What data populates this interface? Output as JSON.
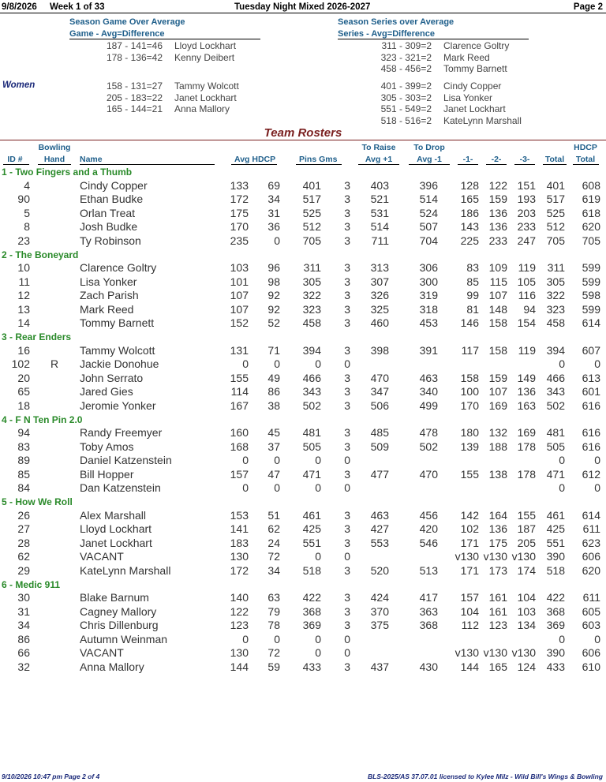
{
  "header": {
    "date": "9/8/2026",
    "week": "Week 1 of 33",
    "league": "Tuesday Night Mixed 2026-2027",
    "page": "Page 2"
  },
  "averages": {
    "game_title": "Season Game Over Average",
    "game_sub": "Game - Avg=Difference",
    "series_title": "Season Series over Average",
    "series_sub": "Series - Avg=Difference",
    "women_label": "Women",
    "men_game": [
      {
        "stat": "187 - 141=46",
        "name": "Lloyd Lockhart"
      },
      {
        "stat": "178 - 136=42",
        "name": "Kenny Deibert"
      }
    ],
    "men_series": [
      {
        "stat": "311 - 309=2",
        "name": "Clarence Goltry"
      },
      {
        "stat": "323 - 321=2",
        "name": "Mark Reed"
      },
      {
        "stat": "458 - 456=2",
        "name": "Tommy Barnett"
      }
    ],
    "women_game": [
      {
        "stat": "158 - 131=27",
        "name": "Tammy Wolcott"
      },
      {
        "stat": "205 - 183=22",
        "name": "Janet Lockhart"
      },
      {
        "stat": "165 - 144=21",
        "name": "Anna Mallory"
      }
    ],
    "women_series": [
      {
        "stat": "401 - 399=2",
        "name": "Cindy Copper"
      },
      {
        "stat": "305 - 303=2",
        "name": "Lisa Yonker"
      },
      {
        "stat": "551 - 549=2",
        "name": "Janet Lockhart"
      },
      {
        "stat": "518 - 516=2",
        "name": "KateLynn Marshall"
      }
    ]
  },
  "rosters": {
    "title": "Team Rosters",
    "headers": {
      "id": "ID #",
      "bowling_line1": "Bowling",
      "bowling_line2": "Hand",
      "name": "Name",
      "avg_hdcp": "Avg HDCP",
      "pins_gms": "Pins Gms",
      "raise_line1": "To Raise",
      "raise_line2": "Avg +1",
      "drop_line1": "To Drop",
      "drop_line2": "Avg -1",
      "g1": "-1-",
      "g2": "-2-",
      "g3": "-3-",
      "total": "Total",
      "hdcp_total_line1": "HDCP",
      "hdcp_total_line2": "Total"
    },
    "teams": [
      {
        "name": "1 - Two Fingers and a Thumb",
        "players": [
          {
            "id": "4",
            "hand": "",
            "name": "Cindy Copper",
            "avg": "133",
            "hdcp": "69",
            "pins": "401",
            "gms": "3",
            "raise": "403",
            "drop": "396",
            "g1": "128",
            "g2": "122",
            "g3": "151",
            "total": "401",
            "hdcp_total": "608"
          },
          {
            "id": "90",
            "hand": "",
            "name": "Ethan Budke",
            "avg": "172",
            "hdcp": "34",
            "pins": "517",
            "gms": "3",
            "raise": "521",
            "drop": "514",
            "g1": "165",
            "g2": "159",
            "g3": "193",
            "total": "517",
            "hdcp_total": "619"
          },
          {
            "id": "5",
            "hand": "",
            "name": "Orlan Treat",
            "avg": "175",
            "hdcp": "31",
            "pins": "525",
            "gms": "3",
            "raise": "531",
            "drop": "524",
            "g1": "186",
            "g2": "136",
            "g3": "203",
            "total": "525",
            "hdcp_total": "618"
          },
          {
            "id": "8",
            "hand": "",
            "name": "Josh Budke",
            "avg": "170",
            "hdcp": "36",
            "pins": "512",
            "gms": "3",
            "raise": "514",
            "drop": "507",
            "g1": "143",
            "g2": "136",
            "g3": "233",
            "total": "512",
            "hdcp_total": "620"
          },
          {
            "id": "23",
            "hand": "",
            "name": "Ty Robinson",
            "avg": "235",
            "hdcp": "0",
            "pins": "705",
            "gms": "3",
            "raise": "711",
            "drop": "704",
            "g1": "225",
            "g2": "233",
            "g3": "247",
            "total": "705",
            "hdcp_total": "705"
          }
        ]
      },
      {
        "name": "2 - The Boneyard",
        "players": [
          {
            "id": "10",
            "hand": "",
            "name": "Clarence Goltry",
            "avg": "103",
            "hdcp": "96",
            "pins": "311",
            "gms": "3",
            "raise": "313",
            "drop": "306",
            "g1": "83",
            "g2": "109",
            "g3": "119",
            "total": "311",
            "hdcp_total": "599"
          },
          {
            "id": "11",
            "hand": "",
            "name": "Lisa Yonker",
            "avg": "101",
            "hdcp": "98",
            "pins": "305",
            "gms": "3",
            "raise": "307",
            "drop": "300",
            "g1": "85",
            "g2": "115",
            "g3": "105",
            "total": "305",
            "hdcp_total": "599"
          },
          {
            "id": "12",
            "hand": "",
            "name": "Zach Parish",
            "avg": "107",
            "hdcp": "92",
            "pins": "322",
            "gms": "3",
            "raise": "326",
            "drop": "319",
            "g1": "99",
            "g2": "107",
            "g3": "116",
            "total": "322",
            "hdcp_total": "598"
          },
          {
            "id": "13",
            "hand": "",
            "name": "Mark Reed",
            "avg": "107",
            "hdcp": "92",
            "pins": "323",
            "gms": "3",
            "raise": "325",
            "drop": "318",
            "g1": "81",
            "g2": "148",
            "g3": "94",
            "total": "323",
            "hdcp_total": "599"
          },
          {
            "id": "14",
            "hand": "",
            "name": "Tommy Barnett",
            "avg": "152",
            "hdcp": "52",
            "pins": "458",
            "gms": "3",
            "raise": "460",
            "drop": "453",
            "g1": "146",
            "g2": "158",
            "g3": "154",
            "total": "458",
            "hdcp_total": "614"
          }
        ]
      },
      {
        "name": "3 - Rear Enders",
        "players": [
          {
            "id": "16",
            "hand": "",
            "name": "Tammy Wolcott",
            "avg": "131",
            "hdcp": "71",
            "pins": "394",
            "gms": "3",
            "raise": "398",
            "drop": "391",
            "g1": "117",
            "g2": "158",
            "g3": "119",
            "total": "394",
            "hdcp_total": "607"
          },
          {
            "id": "102",
            "hand": "R",
            "name": "Jackie Donohue",
            "avg": "0",
            "hdcp": "0",
            "pins": "0",
            "gms": "0",
            "raise": "",
            "drop": "",
            "g1": "",
            "g2": "",
            "g3": "",
            "total": "0",
            "hdcp_total": "0"
          },
          {
            "id": "20",
            "hand": "",
            "name": "John Serrato",
            "avg": "155",
            "hdcp": "49",
            "pins": "466",
            "gms": "3",
            "raise": "470",
            "drop": "463",
            "g1": "158",
            "g2": "159",
            "g3": "149",
            "total": "466",
            "hdcp_total": "613"
          },
          {
            "id": "65",
            "hand": "",
            "name": "Jared Gies",
            "avg": "114",
            "hdcp": "86",
            "pins": "343",
            "gms": "3",
            "raise": "347",
            "drop": "340",
            "g1": "100",
            "g2": "107",
            "g3": "136",
            "total": "343",
            "hdcp_total": "601"
          },
          {
            "id": "18",
            "hand": "",
            "name": "Jeromie Yonker",
            "avg": "167",
            "hdcp": "38",
            "pins": "502",
            "gms": "3",
            "raise": "506",
            "drop": "499",
            "g1": "170",
            "g2": "169",
            "g3": "163",
            "total": "502",
            "hdcp_total": "616"
          }
        ]
      },
      {
        "name": "4 - F N Ten Pin 2.0",
        "players": [
          {
            "id": "94",
            "hand": "",
            "name": "Randy Freemyer",
            "avg": "160",
            "hdcp": "45",
            "pins": "481",
            "gms": "3",
            "raise": "485",
            "drop": "478",
            "g1": "180",
            "g2": "132",
            "g3": "169",
            "total": "481",
            "hdcp_total": "616"
          },
          {
            "id": "83",
            "hand": "",
            "name": "Toby Amos",
            "avg": "168",
            "hdcp": "37",
            "pins": "505",
            "gms": "3",
            "raise": "509",
            "drop": "502",
            "g1": "139",
            "g2": "188",
            "g3": "178",
            "total": "505",
            "hdcp_total": "616"
          },
          {
            "id": "89",
            "hand": "",
            "name": "Daniel Katzenstein",
            "avg": "0",
            "hdcp": "0",
            "pins": "0",
            "gms": "0",
            "raise": "",
            "drop": "",
            "g1": "",
            "g2": "",
            "g3": "",
            "total": "0",
            "hdcp_total": "0"
          },
          {
            "id": "85",
            "hand": "",
            "name": "Bill Hopper",
            "avg": "157",
            "hdcp": "47",
            "pins": "471",
            "gms": "3",
            "raise": "477",
            "drop": "470",
            "g1": "155",
            "g2": "138",
            "g3": "178",
            "total": "471",
            "hdcp_total": "612"
          },
          {
            "id": "84",
            "hand": "",
            "name": "Dan Katzenstein",
            "avg": "0",
            "hdcp": "0",
            "pins": "0",
            "gms": "0",
            "raise": "",
            "drop": "",
            "g1": "",
            "g2": "",
            "g3": "",
            "total": "0",
            "hdcp_total": "0"
          }
        ]
      },
      {
        "name": "5 - How We Roll",
        "players": [
          {
            "id": "26",
            "hand": "",
            "name": "Alex Marshall",
            "avg": "153",
            "hdcp": "51",
            "pins": "461",
            "gms": "3",
            "raise": "463",
            "drop": "456",
            "g1": "142",
            "g2": "164",
            "g3": "155",
            "total": "461",
            "hdcp_total": "614"
          },
          {
            "id": "27",
            "hand": "",
            "name": "Lloyd Lockhart",
            "avg": "141",
            "hdcp": "62",
            "pins": "425",
            "gms": "3",
            "raise": "427",
            "drop": "420",
            "g1": "102",
            "g2": "136",
            "g3": "187",
            "total": "425",
            "hdcp_total": "611"
          },
          {
            "id": "28",
            "hand": "",
            "name": "Janet Lockhart",
            "avg": "183",
            "hdcp": "24",
            "pins": "551",
            "gms": "3",
            "raise": "553",
            "drop": "546",
            "g1": "171",
            "g2": "175",
            "g3": "205",
            "total": "551",
            "hdcp_total": "623"
          },
          {
            "id": "62",
            "hand": "",
            "name": "VACANT",
            "avg": "130",
            "hdcp": "72",
            "pins": "0",
            "gms": "0",
            "raise": "",
            "drop": "",
            "g1": "v130",
            "g2": "v130",
            "g3": "v130",
            "total": "390",
            "hdcp_total": "606"
          },
          {
            "id": "29",
            "hand": "",
            "name": "KateLynn Marshall",
            "avg": "172",
            "hdcp": "34",
            "pins": "518",
            "gms": "3",
            "raise": "520",
            "drop": "513",
            "g1": "171",
            "g2": "173",
            "g3": "174",
            "total": "518",
            "hdcp_total": "620"
          }
        ]
      },
      {
        "name": "6 - Medic 911",
        "players": [
          {
            "id": "30",
            "hand": "",
            "name": "Blake Barnum",
            "avg": "140",
            "hdcp": "63",
            "pins": "422",
            "gms": "3",
            "raise": "424",
            "drop": "417",
            "g1": "157",
            "g2": "161",
            "g3": "104",
            "total": "422",
            "hdcp_total": "611"
          },
          {
            "id": "31",
            "hand": "",
            "name": "Cagney Mallory",
            "avg": "122",
            "hdcp": "79",
            "pins": "368",
            "gms": "3",
            "raise": "370",
            "drop": "363",
            "g1": "104",
            "g2": "161",
            "g3": "103",
            "total": "368",
            "hdcp_total": "605"
          },
          {
            "id": "34",
            "hand": "",
            "name": "Chris Dillenburg",
            "avg": "123",
            "hdcp": "78",
            "pins": "369",
            "gms": "3",
            "raise": "375",
            "drop": "368",
            "g1": "112",
            "g2": "123",
            "g3": "134",
            "total": "369",
            "hdcp_total": "603"
          },
          {
            "id": "86",
            "hand": "",
            "name": "Autumn Weinman",
            "avg": "0",
            "hdcp": "0",
            "pins": "0",
            "gms": "0",
            "raise": "",
            "drop": "",
            "g1": "",
            "g2": "",
            "g3": "",
            "total": "0",
            "hdcp_total": "0"
          },
          {
            "id": "66",
            "hand": "",
            "name": "VACANT",
            "avg": "130",
            "hdcp": "72",
            "pins": "0",
            "gms": "0",
            "raise": "",
            "drop": "",
            "g1": "v130",
            "g2": "v130",
            "g3": "v130",
            "total": "390",
            "hdcp_total": "606"
          },
          {
            "id": "32",
            "hand": "",
            "name": "Anna Mallory",
            "avg": "144",
            "hdcp": "59",
            "pins": "433",
            "gms": "3",
            "raise": "437",
            "drop": "430",
            "g1": "144",
            "g2": "165",
            "g3": "124",
            "total": "433",
            "hdcp_total": "610"
          }
        ]
      }
    ]
  },
  "footer": {
    "printed": "9/10/2026  10:47 pm  Page 2 of 4",
    "license": "BLS-2025/AS 37.07.01 licensed to Kylee Milz - Wild Bill's Wings & Bowling"
  }
}
